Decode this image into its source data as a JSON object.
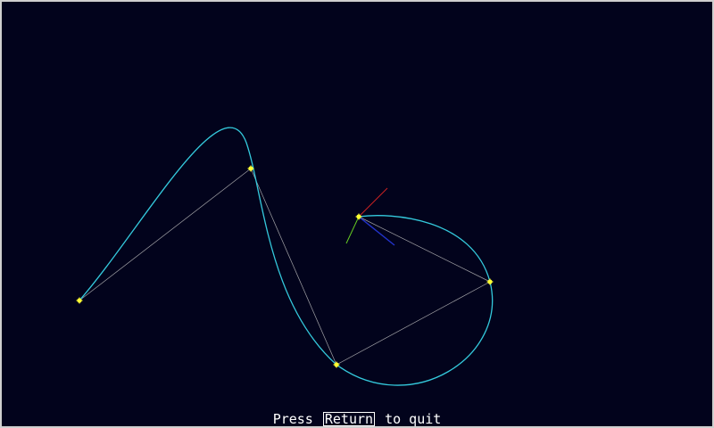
{
  "colors": {
    "background": "#02031c",
    "frame": "#cfcfcf",
    "curve": "#34c9dc",
    "control_polygon": "#bfbfbf",
    "control_point": "#ffff33",
    "axis_x": "#cc2222",
    "axis_y": "#66cc22",
    "axis_z": "#2233cc",
    "status_text": "#ffffff"
  },
  "icons": {
    "control_point": "control-point-marker-icon",
    "axes_gizmo": "axes-gizmo-icon"
  },
  "status": {
    "press": "Press",
    "key": "Return",
    "suffix": "to quit"
  }
}
